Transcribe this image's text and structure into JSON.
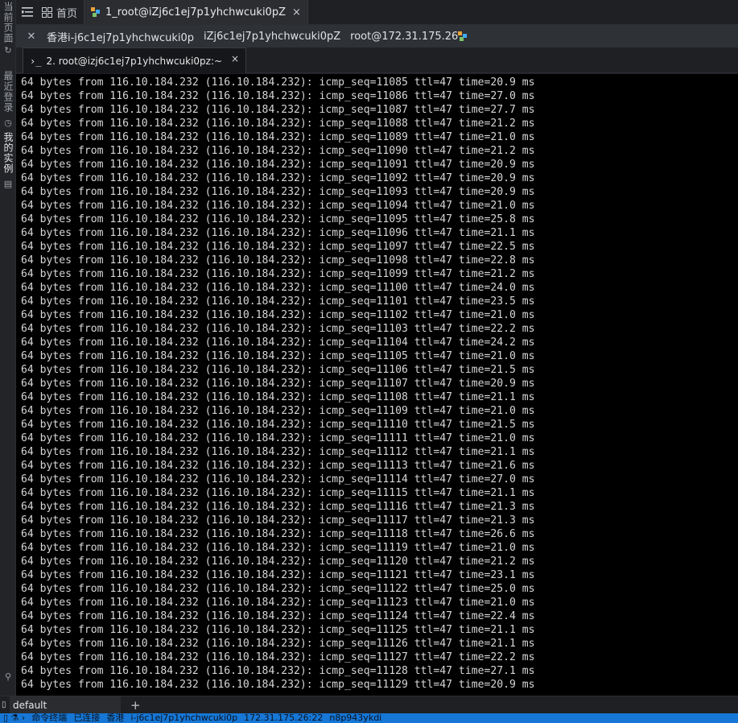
{
  "sidebar": {
    "items": [
      {
        "label": "当前页面",
        "icon": "refresh-icon"
      },
      {
        "label": "最近登录",
        "icon": "clock-icon"
      },
      {
        "label": "我的实例",
        "icon": "server-icon"
      }
    ]
  },
  "topbar": {
    "home_label": "首页",
    "active_tab_label": "1_root@iZj6c1ej7p1yhchwcuki0pZ",
    "close_symbol": "×"
  },
  "connection": {
    "region_name": "香港i-j6c1ej7p1yhchwcuki0p",
    "host_name": "iZj6c1ej7p1yhchwcuki0pZ",
    "user_ip": "root@172.31.175.26"
  },
  "session_tab": {
    "label": "2. root@izj6c1ej7p1yhchwcuki0pz:~",
    "close_symbol": "×"
  },
  "terminal": {
    "prefix": "64 bytes from 116.10.184.232 (116.10.184.232): ",
    "lines": [
      "64 bytes from 116.10.184.232 (116.10.184.232): icmp_seq=11085 ttl=47 time=20.9 ms",
      "64 bytes from 116.10.184.232 (116.10.184.232): icmp_seq=11086 ttl=47 time=27.0 ms",
      "64 bytes from 116.10.184.232 (116.10.184.232): icmp_seq=11087 ttl=47 time=27.7 ms",
      "64 bytes from 116.10.184.232 (116.10.184.232): icmp_seq=11088 ttl=47 time=21.2 ms",
      "64 bytes from 116.10.184.232 (116.10.184.232): icmp_seq=11089 ttl=47 time=21.0 ms",
      "64 bytes from 116.10.184.232 (116.10.184.232): icmp_seq=11090 ttl=47 time=21.2 ms",
      "64 bytes from 116.10.184.232 (116.10.184.232): icmp_seq=11091 ttl=47 time=20.9 ms",
      "64 bytes from 116.10.184.232 (116.10.184.232): icmp_seq=11092 ttl=47 time=20.9 ms",
      "64 bytes from 116.10.184.232 (116.10.184.232): icmp_seq=11093 ttl=47 time=20.9 ms",
      "64 bytes from 116.10.184.232 (116.10.184.232): icmp_seq=11094 ttl=47 time=21.0 ms",
      "64 bytes from 116.10.184.232 (116.10.184.232): icmp_seq=11095 ttl=47 time=25.8 ms",
      "64 bytes from 116.10.184.232 (116.10.184.232): icmp_seq=11096 ttl=47 time=21.1 ms",
      "64 bytes from 116.10.184.232 (116.10.184.232): icmp_seq=11097 ttl=47 time=22.5 ms",
      "64 bytes from 116.10.184.232 (116.10.184.232): icmp_seq=11098 ttl=47 time=22.8 ms",
      "64 bytes from 116.10.184.232 (116.10.184.232): icmp_seq=11099 ttl=47 time=21.2 ms",
      "64 bytes from 116.10.184.232 (116.10.184.232): icmp_seq=11100 ttl=47 time=24.0 ms",
      "64 bytes from 116.10.184.232 (116.10.184.232): icmp_seq=11101 ttl=47 time=23.5 ms",
      "64 bytes from 116.10.184.232 (116.10.184.232): icmp_seq=11102 ttl=47 time=21.0 ms",
      "64 bytes from 116.10.184.232 (116.10.184.232): icmp_seq=11103 ttl=47 time=22.2 ms",
      "64 bytes from 116.10.184.232 (116.10.184.232): icmp_seq=11104 ttl=47 time=24.2 ms",
      "64 bytes from 116.10.184.232 (116.10.184.232): icmp_seq=11105 ttl=47 time=21.0 ms",
      "64 bytes from 116.10.184.232 (116.10.184.232): icmp_seq=11106 ttl=47 time=21.5 ms",
      "64 bytes from 116.10.184.232 (116.10.184.232): icmp_seq=11107 ttl=47 time=20.9 ms",
      "64 bytes from 116.10.184.232 (116.10.184.232): icmp_seq=11108 ttl=47 time=21.1 ms",
      "64 bytes from 116.10.184.232 (116.10.184.232): icmp_seq=11109 ttl=47 time=21.0 ms",
      "64 bytes from 116.10.184.232 (116.10.184.232): icmp_seq=11110 ttl=47 time=21.5 ms",
      "64 bytes from 116.10.184.232 (116.10.184.232): icmp_seq=11111 ttl=47 time=21.0 ms",
      "64 bytes from 116.10.184.232 (116.10.184.232): icmp_seq=11112 ttl=47 time=21.1 ms",
      "64 bytes from 116.10.184.232 (116.10.184.232): icmp_seq=11113 ttl=47 time=21.6 ms",
      "64 bytes from 116.10.184.232 (116.10.184.232): icmp_seq=11114 ttl=47 time=27.0 ms",
      "64 bytes from 116.10.184.232 (116.10.184.232): icmp_seq=11115 ttl=47 time=21.1 ms",
      "64 bytes from 116.10.184.232 (116.10.184.232): icmp_seq=11116 ttl=47 time=21.3 ms",
      "64 bytes from 116.10.184.232 (116.10.184.232): icmp_seq=11117 ttl=47 time=21.3 ms",
      "64 bytes from 116.10.184.232 (116.10.184.232): icmp_seq=11118 ttl=47 time=26.6 ms",
      "64 bytes from 116.10.184.232 (116.10.184.232): icmp_seq=11119 ttl=47 time=21.0 ms",
      "64 bytes from 116.10.184.232 (116.10.184.232): icmp_seq=11120 ttl=47 time=21.2 ms",
      "64 bytes from 116.10.184.232 (116.10.184.232): icmp_seq=11121 ttl=47 time=23.1 ms",
      "64 bytes from 116.10.184.232 (116.10.184.232): icmp_seq=11122 ttl=47 time=25.0 ms",
      "64 bytes from 116.10.184.232 (116.10.184.232): icmp_seq=11123 ttl=47 time=21.0 ms",
      "64 bytes from 116.10.184.232 (116.10.184.232): icmp_seq=11124 ttl=47 time=22.4 ms",
      "64 bytes from 116.10.184.232 (116.10.184.232): icmp_seq=11125 ttl=47 time=21.1 ms",
      "64 bytes from 116.10.184.232 (116.10.184.232): icmp_seq=11126 ttl=47 time=21.1 ms",
      "64 bytes from 116.10.184.232 (116.10.184.232): icmp_seq=11127 ttl=47 time=22.2 ms",
      "64 bytes from 116.10.184.232 (116.10.184.232): icmp_seq=11128 ttl=47 time=27.1 ms",
      "64 bytes from 116.10.184.232 (116.10.184.232): icmp_seq=11129 ttl=47 time=20.9 ms"
    ]
  },
  "bottom": {
    "default_tab_label": "default",
    "add_symbol": "+"
  },
  "statusbar": {
    "items": [
      "命令终端",
      "已连接",
      "香港",
      "i-j6c1ej7p1yhchwcuki0p",
      "172.31.175.26:22",
      "n8p943ykdi"
    ]
  },
  "colors": {
    "status_bar": "#1677d6",
    "terminal_bg": "#000000",
    "terminal_fg": "#d6d6d6",
    "connection_bar": "#2e3136"
  }
}
